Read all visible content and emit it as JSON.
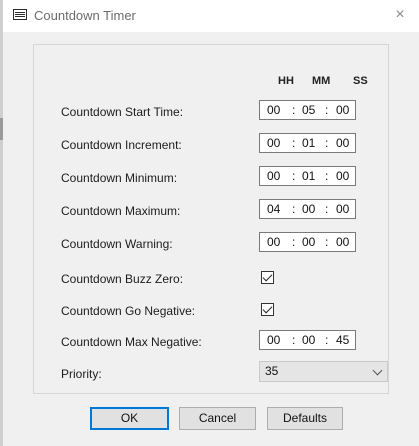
{
  "window": {
    "title": "Countdown Timer",
    "close_glyph": "×"
  },
  "columns": {
    "hh": "HH",
    "mm": "MM",
    "ss": "SS"
  },
  "separator": ":",
  "rows": [
    {
      "label": "Countdown Start Time:",
      "hh": "00",
      "mm": "05",
      "ss": "00"
    },
    {
      "label": "Countdown Increment:",
      "hh": "00",
      "mm": "01",
      "ss": "00"
    },
    {
      "label": "Countdown Minimum:",
      "hh": "00",
      "mm": "01",
      "ss": "00"
    },
    {
      "label": "Countdown Maximum:",
      "hh": "04",
      "mm": "00",
      "ss": "00"
    },
    {
      "label": "Countdown Warning:",
      "hh": "00",
      "mm": "00",
      "ss": "00"
    },
    {
      "label": "Countdown Buzz Zero:",
      "checked": true
    },
    {
      "label": "Countdown Go Negative:",
      "checked": true
    },
    {
      "label": "Countdown Max Negative:",
      "hh": "00",
      "mm": "00",
      "ss": "45"
    }
  ],
  "priority": {
    "label": "Priority:",
    "value": "35"
  },
  "buttons": {
    "ok": "OK",
    "cancel": "Cancel",
    "defaults": "Defaults"
  },
  "icons": {
    "title": "window-icon",
    "close": "close-icon",
    "dropdown": "chevron-down-icon",
    "check": "checkmark-icon"
  }
}
